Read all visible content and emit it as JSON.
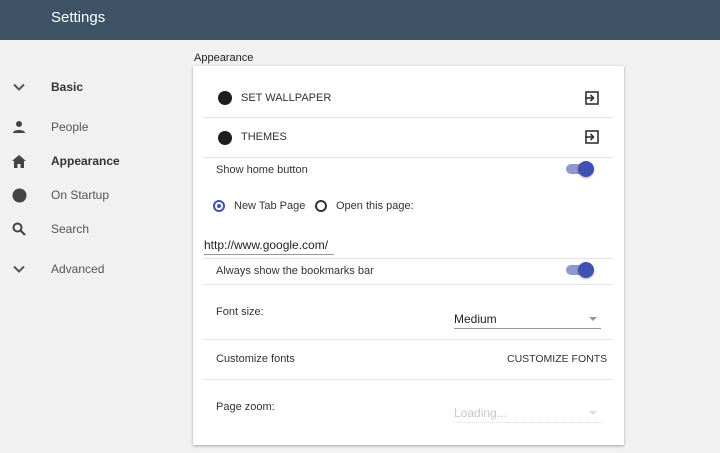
{
  "header": {
    "title": "Settings"
  },
  "nav": {
    "items": [
      {
        "label": "Basic",
        "icon": "chevron-down-icon"
      },
      {
        "label": "People",
        "icon": "person-icon"
      },
      {
        "label": "Appearance",
        "icon": "home-icon"
      },
      {
        "label": "On Startup",
        "icon": "circle-icon"
      },
      {
        "label": "Search",
        "icon": "search-icon"
      },
      {
        "label": "Advanced",
        "icon": "chevron-down-icon"
      }
    ]
  },
  "appearance": {
    "section_title": "Appearance",
    "wallpaper_label": "SET WALLPAPER",
    "themes_label": "THEMES",
    "home_button_label": "Show home button",
    "home_button_enabled": true,
    "radio_new_tab": "New Tab Page",
    "radio_open_page": "Open this page:",
    "radio_selected": "New Tab Page",
    "home_url": "http://www.google.com/",
    "bookmarks_bar_label": "Always show the bookmarks bar",
    "bookmarks_bar_enabled": true,
    "font_size_label": "Font size:",
    "font_size_value": "Medium",
    "customize_fonts_label": "Customize fonts",
    "customize_fonts_button": "CUSTOMIZE FONTS",
    "page_zoom_label": "Page zoom:",
    "page_zoom_value": "Loading..."
  },
  "colors": {
    "header": "#3e5366",
    "accent": "#3f51b5",
    "toggle_track": "#8f98cf"
  }
}
